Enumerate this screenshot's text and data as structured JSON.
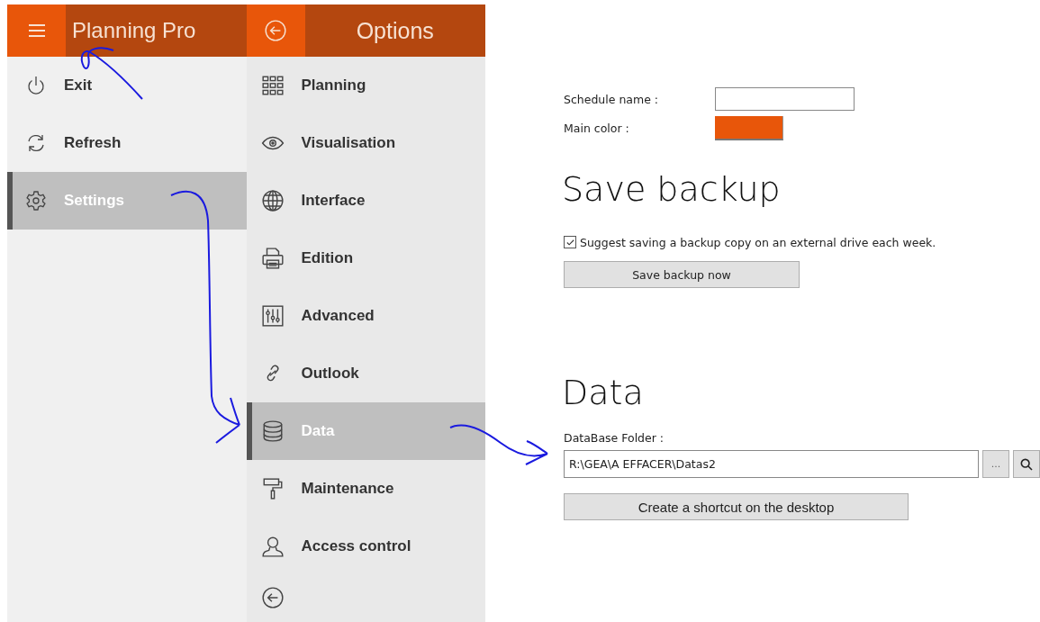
{
  "app": {
    "title": "Planning Pro"
  },
  "main_menu": [
    {
      "label": "Exit",
      "selected": false
    },
    {
      "label": "Refresh",
      "selected": false
    },
    {
      "label": "Settings",
      "selected": true
    }
  ],
  "options": {
    "title": "Options",
    "items": [
      {
        "label": "Planning",
        "selected": false
      },
      {
        "label": "Visualisation",
        "selected": false
      },
      {
        "label": "Interface",
        "selected": false
      },
      {
        "label": "Edition",
        "selected": false
      },
      {
        "label": "Advanced",
        "selected": false
      },
      {
        "label": "Outlook",
        "selected": false
      },
      {
        "label": "Data",
        "selected": true
      },
      {
        "label": "Maintenance",
        "selected": false
      },
      {
        "label": "Access control",
        "selected": false
      }
    ]
  },
  "general": {
    "schedule_name_label": "Schedule name :",
    "main_color": {
      "label": "Main color :",
      "color": "#e8560a"
    }
  },
  "save_backup": {
    "heading": "Save backup",
    "checkbox": {
      "label": "Suggest saving a backup copy on an external drive each week.",
      "checked": true
    },
    "button": "Save backup now"
  },
  "data": {
    "heading": "Data",
    "folder_label": "DataBase Folder :",
    "folder_value": "R:\\GEA\\A EFFACER\\Datas2",
    "browse_button": "...",
    "shortcut_button": "Create a shortcut on the desktop"
  }
}
